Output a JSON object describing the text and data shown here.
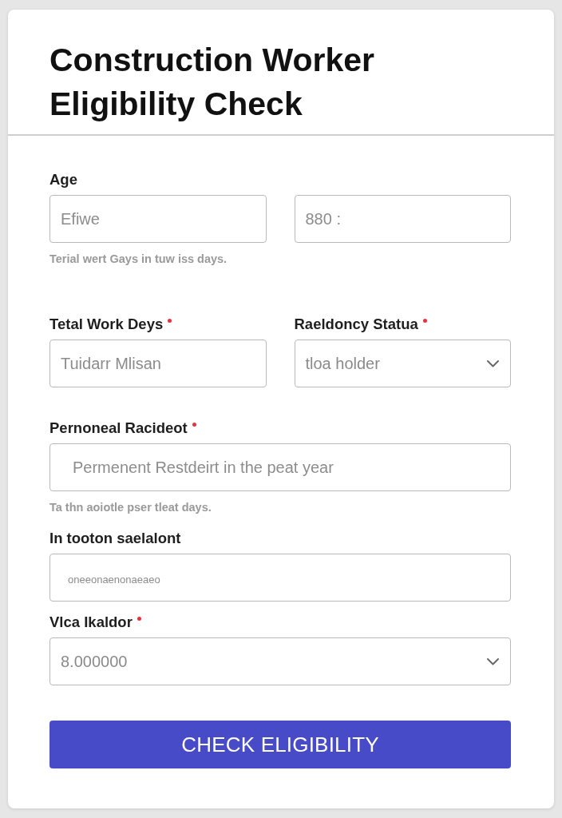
{
  "card": {
    "title": "Construction Worker Eligibility Check"
  },
  "form": {
    "rows": [
      {
        "fields": [
          {
            "label": "Age",
            "required": false,
            "kind": "input",
            "placeholder": "Efiwe"
          },
          {
            "required": false,
            "kind": "input",
            "placeholder": "880 :"
          }
        ],
        "hint": "Terial wert Gays in tuw iss days."
      },
      {
        "fields": [
          {
            "label": "Tetal Work Deys",
            "required": true,
            "kind": "input",
            "placeholder": "Tuidarr Mlisan"
          },
          {
            "label": "Raeldoncy Statua",
            "required": true,
            "kind": "select",
            "placeholder": "tloa holder"
          }
        ]
      },
      {
        "fields": [
          {
            "label": "Pernoneal Racideot",
            "required": true,
            "kind": "input",
            "placeholder": "Permenent Restdeirt in the peat year"
          }
        ],
        "hint": "Ta thn aoiotle pser tleat days."
      },
      {
        "fields": [
          {
            "label": "In tooton saelalont",
            "required": false,
            "kind": "input",
            "placeholder": "oneeonaenonaeaeo"
          }
        ]
      },
      {
        "fields": [
          {
            "label": "Vlca Ikaldor",
            "required": true,
            "kind": "select",
            "placeholder": "8.000000"
          }
        ]
      }
    ]
  },
  "submit_button": {
    "label": "CHECK ELIGIBILITY"
  }
}
